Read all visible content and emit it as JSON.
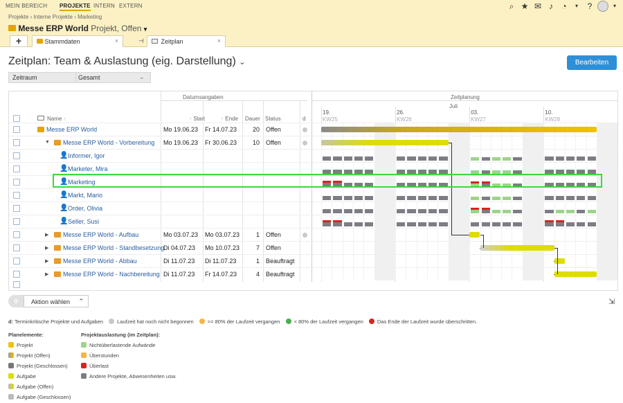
{
  "nav": {
    "items": [
      "MEIN BEREICH",
      "PROJEKTE",
      "INTERN",
      "EXTERN"
    ],
    "active": "PROJEKTE"
  },
  "breadcrumb": [
    "Projekte",
    "Interne Projekte",
    "Marketing"
  ],
  "project": {
    "title": "Messe ERP World",
    "subtitle": "Projekt, Offen"
  },
  "tabs": [
    {
      "label": "Stammdaten"
    },
    {
      "label": "Zeitplan"
    }
  ],
  "page": {
    "title": "Zeitplan: Team & Auslastung (eig. Darstellung)",
    "edit_label": "Bearbeiten"
  },
  "filter": {
    "label": "Zeitraum",
    "value": "Gesamt"
  },
  "grid": {
    "group_dates": "Datumsangaben",
    "group_plan": "Zeitplanung",
    "month": "Juli",
    "columns": {
      "name": "Name",
      "start": "Start",
      "end": "Ende",
      "duration": "Dauer",
      "status": "Status",
      "d": "d"
    },
    "weeks": [
      {
        "day": "19.",
        "kw": "KW25"
      },
      {
        "day": "26.",
        "kw": "KW26"
      },
      {
        "day": "03.",
        "kw": "KW27"
      },
      {
        "day": "10.",
        "kw": "KW28"
      }
    ],
    "rows": [
      {
        "name": "Messe ERP World",
        "start": "Mo 19.06.23",
        "end": "Fr 14.07.23",
        "duration": "20",
        "status": "Offen"
      },
      {
        "name": "Messe ERP World - Vorbereitung",
        "start": "Mo 19.06.23",
        "end": "Fr 30.06.23",
        "duration": "10",
        "status": "Offen"
      },
      {
        "name": "Informer, Igor",
        "start": "",
        "end": "",
        "duration": "",
        "status": ""
      },
      {
        "name": "Marketer, Mira",
        "start": "",
        "end": "",
        "duration": "",
        "status": ""
      },
      {
        "name": "Marketing",
        "start": "",
        "end": "",
        "duration": "",
        "status": ""
      },
      {
        "name": "Markt, Mario",
        "start": "",
        "end": "",
        "duration": "",
        "status": ""
      },
      {
        "name": "Order, Olivia",
        "start": "",
        "end": "",
        "duration": "",
        "status": ""
      },
      {
        "name": "Seller, Susi",
        "start": "",
        "end": "",
        "duration": "",
        "status": ""
      },
      {
        "name": "Messe ERP World - Aufbau",
        "start": "Mo 03.07.23",
        "end": "Mo 03.07.23",
        "duration": "1",
        "status": "Offen"
      },
      {
        "name": "Messe ERP World - Standbesetzung",
        "start": "Di 04.07.23",
        "end": "Mo 10.07.23",
        "duration": "7",
        "status": "Offen"
      },
      {
        "name": "Messe ERP World - Abbau",
        "start": "Di 11.07.23",
        "end": "Di 11.07.23",
        "duration": "1",
        "status": "Beauftragt"
      },
      {
        "name": "Messe ERP World - Nachbereitung",
        "start": "Di 11.07.23",
        "end": "Fr 14.07.23",
        "duration": "4",
        "status": "Beauftragt"
      }
    ]
  },
  "action": {
    "count": "0",
    "label": "Aktion wählen"
  },
  "legend": {
    "d_prefix": "d:",
    "d_text": "Terminkritische Projekte und Aufgaben",
    "d_items": [
      "Laufzeit hat noch nicht begonnen",
      ">= 80% der Laufzeit vergangen",
      "< 80% der Laufzeit vergangen",
      "Das Ende der Laufzeit wurde überschritten."
    ],
    "plan_title": "Planelemente:",
    "plan_items": [
      "Projekt",
      "Projekt (Offen)",
      "Projekt (Geschlossen)",
      "Aufgabe",
      "Aufgabe (Offen)",
      "Aufgabe (Geschlossen)"
    ],
    "load_title": "Projektauslastung (im Zeitplan):",
    "load_items": [
      "Nichtüberlastende Aufwände",
      "Überstunden",
      "Überlast",
      "Andere Projekte, Abwesenheiten usw."
    ]
  },
  "colors": {
    "accent": "#2e8fd6",
    "project": "#f2c200",
    "task": "#dddd00",
    "load_ok": "#9ed48a",
    "load_overtime": "#f5b642",
    "load_over": "#d9241f",
    "load_other": "#7d7d85",
    "highlight": "#3bd93b"
  }
}
